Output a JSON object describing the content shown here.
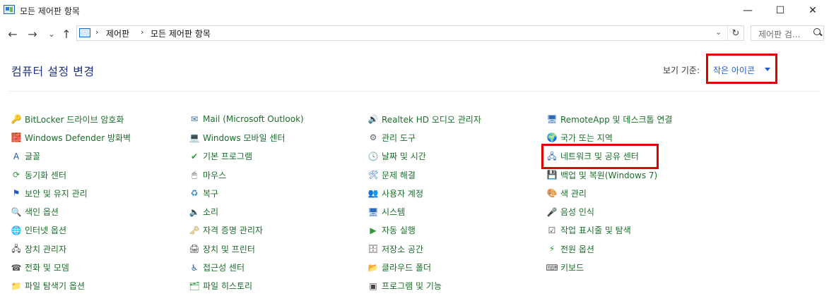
{
  "window": {
    "title": "모든 제어판 항목",
    "min_glyph": "—",
    "max_glyph": "☐",
    "close_glyph": "✕"
  },
  "nav": {
    "back_glyph": "←",
    "forward_glyph": "→",
    "recent_glyph": "⌄",
    "up_glyph": "↑"
  },
  "address": {
    "sep1": "›",
    "crumb1": "제어판",
    "sep2": "›",
    "crumb2": "모든 제어판 항목",
    "dropdown_glyph": "⌄",
    "refresh_glyph": "↻"
  },
  "search": {
    "placeholder": "제어판 검..."
  },
  "header": {
    "title": "컴퓨터 설정 변경",
    "view_by_label": "보기 기준:",
    "view_by_value": "작은 아이콘"
  },
  "columns": [
    [
      {
        "label": "BitLocker 드라이브 암호화",
        "icon": "bitlocker-icon",
        "glyph": "🔑",
        "color": "#b8860b"
      },
      {
        "label": "Windows Defender 방화벽",
        "icon": "firewall-icon",
        "glyph": "🧱",
        "color": "#b34a1a"
      },
      {
        "label": "글꼴",
        "icon": "font-icon",
        "glyph": "A",
        "color": "#1e5aa8"
      },
      {
        "label": "동기화 센터",
        "icon": "sync-icon",
        "glyph": "⟳",
        "color": "#2e9a3a"
      },
      {
        "label": "보안 및 유지 관리",
        "icon": "flag-icon",
        "glyph": "⚑",
        "color": "#2a5ab8"
      },
      {
        "label": "색인 옵션",
        "icon": "indexing-icon",
        "glyph": "🔍",
        "color": "#555555"
      },
      {
        "label": "인터넷 옵션",
        "icon": "internet-icon",
        "glyph": "🌐",
        "color": "#2a7ab8"
      },
      {
        "label": "장치 관리자",
        "icon": "device-manager-icon",
        "glyph": "🖧",
        "color": "#444444"
      },
      {
        "label": "전화 및 모뎀",
        "icon": "phone-modem-icon",
        "glyph": "☎",
        "color": "#555555"
      },
      {
        "label": "파일 탐색기 옵션",
        "icon": "folder-options-icon",
        "glyph": "📁",
        "color": "#d4a017"
      }
    ],
    [
      {
        "label": "Mail (Microsoft Outlook)",
        "icon": "mail-icon",
        "glyph": "✉",
        "color": "#2a6ab8"
      },
      {
        "label": "Windows 모바일 센터",
        "icon": "mobility-center-icon",
        "glyph": "💻",
        "color": "#2a6ab8"
      },
      {
        "label": "기본 프로그램",
        "icon": "default-programs-icon",
        "glyph": "✔",
        "color": "#2e9a3a"
      },
      {
        "label": "마우스",
        "icon": "mouse-icon",
        "glyph": "🖱",
        "color": "#555555"
      },
      {
        "label": "복구",
        "icon": "recovery-icon",
        "glyph": "♻",
        "color": "#2e8ac0"
      },
      {
        "label": "소리",
        "icon": "sound-icon",
        "glyph": "🔈",
        "color": "#555555"
      },
      {
        "label": "자격 증명 관리자",
        "icon": "credential-icon",
        "glyph": "🗝",
        "color": "#b8860b"
      },
      {
        "label": "장치 및 프린터",
        "icon": "printer-icon",
        "glyph": "🖨",
        "color": "#444444"
      },
      {
        "label": "접근성 센터",
        "icon": "accessibility-icon",
        "glyph": "♿",
        "color": "#2a5ab8"
      },
      {
        "label": "파일 히스토리",
        "icon": "file-history-icon",
        "glyph": "🗂",
        "color": "#2e9a3a"
      }
    ],
    [
      {
        "label": "Realtek HD 오디오 관리자",
        "icon": "realtek-audio-icon",
        "glyph": "🔊",
        "color": "#2a5ab8"
      },
      {
        "label": "관리 도구",
        "icon": "admin-tools-icon",
        "glyph": "⚙",
        "color": "#666666"
      },
      {
        "label": "날짜 및 시간",
        "icon": "clock-icon",
        "glyph": "🕓",
        "color": "#2a6ab8"
      },
      {
        "label": "문제 해결",
        "icon": "troubleshoot-icon",
        "glyph": "🛠",
        "color": "#2a6ab8"
      },
      {
        "label": "사용자 계정",
        "icon": "user-accounts-icon",
        "glyph": "👥",
        "color": "#555555"
      },
      {
        "label": "시스템",
        "icon": "system-icon",
        "glyph": "🖥",
        "color": "#2a6ab8"
      },
      {
        "label": "자동 실행",
        "icon": "autoplay-icon",
        "glyph": "▶",
        "color": "#2e9a3a"
      },
      {
        "label": "저장소 공간",
        "icon": "storage-icon",
        "glyph": "🗄",
        "color": "#666666"
      },
      {
        "label": "클라우드 폴더",
        "icon": "work-folders-icon",
        "glyph": "📂",
        "color": "#d4a017"
      },
      {
        "label": "프로그램 및 기능",
        "icon": "programs-features-icon",
        "glyph": "▣",
        "color": "#444444"
      }
    ],
    [
      {
        "label": "RemoteApp 및 데스크톱 연결",
        "icon": "remoteapp-icon",
        "glyph": "🖥",
        "color": "#2a6ab8"
      },
      {
        "label": "국가 또는 지역",
        "icon": "region-icon",
        "glyph": "🌍",
        "color": "#2a7ab8"
      },
      {
        "label": "네트워크 및 공유 센터",
        "icon": "network-icon",
        "glyph": "🖧",
        "color": "#2a6ab8"
      },
      {
        "label": "백업 및 복원(Windows 7)",
        "icon": "backup-icon",
        "glyph": "💾",
        "color": "#2e9a3a"
      },
      {
        "label": "색 관리",
        "icon": "color-management-icon",
        "glyph": "🎨",
        "color": "#b8332a"
      },
      {
        "label": "음성 인식",
        "icon": "speech-icon",
        "glyph": "🎤",
        "color": "#555555"
      },
      {
        "label": "작업 표시줄 및 탐색",
        "icon": "taskbar-icon",
        "glyph": "☑",
        "color": "#444444"
      },
      {
        "label": "전원 옵션",
        "icon": "power-icon",
        "glyph": "⚡",
        "color": "#2e9a3a"
      },
      {
        "label": "키보드",
        "icon": "keyboard-icon",
        "glyph": "⌨",
        "color": "#555555"
      }
    ]
  ]
}
